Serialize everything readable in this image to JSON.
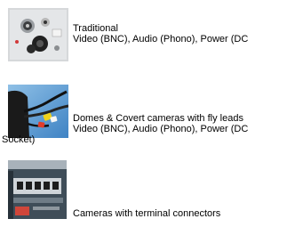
{
  "items": [
    {
      "image": "connector-panel-image",
      "lines": [
        "Traditional",
        "Video (BNC), Audio (Phono), Power (DC"
      ]
    },
    {
      "image": "fly-lead-cables-image",
      "lines": [
        "Domes & Covert cameras with fly leads",
        "Video (BNC), Audio (Phono), Power (DC"
      ],
      "wrap": "Socket)"
    },
    {
      "image": "terminal-connector-image",
      "lines": [
        "Cameras with terminal connectors"
      ]
    }
  ]
}
